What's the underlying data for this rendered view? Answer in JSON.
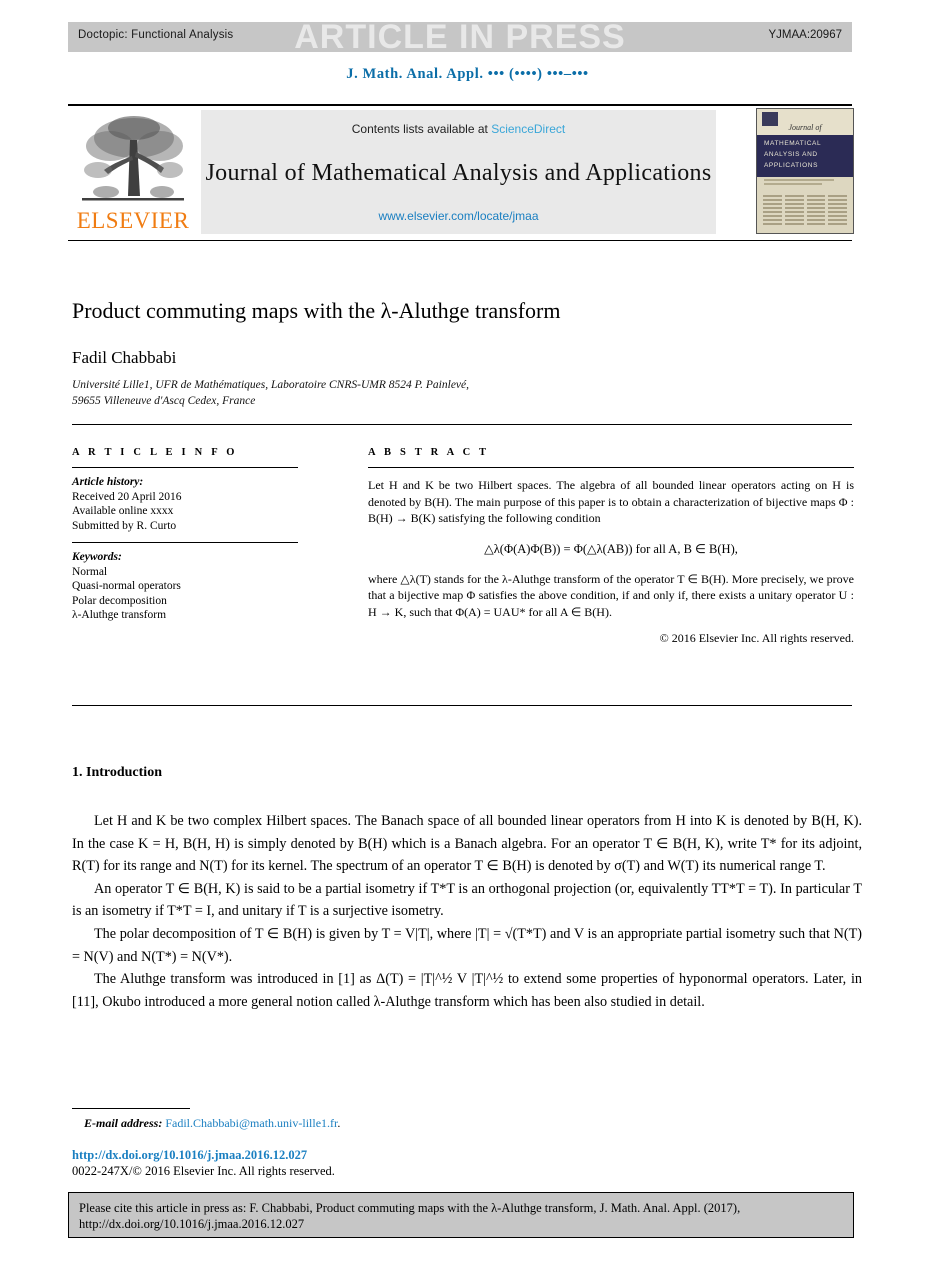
{
  "header": {
    "doctopic": "Doctopic: Functional Analysis",
    "press_banner": "ARTICLE IN PRESS",
    "article_number": "YJMAA:20967",
    "running_head": "J. Math. Anal. Appl. ••• (••••) •••–•••"
  },
  "masthead": {
    "contents_prefix": "Contents lists available at",
    "contents_link": "ScienceDirect",
    "journal_title": "Journal of Mathematical Analysis and Applications",
    "journal_url": "www.elsevier.com/locate/jmaa",
    "publisher": "ELSEVIER",
    "publisher_logo": "elsevier-tree-logo",
    "cover": {
      "journal_of": "Journal of",
      "band_line1": "MATHEMATICAL",
      "band_line2": "ANALYSIS AND",
      "band_line3": "APPLICATIONS"
    }
  },
  "article": {
    "title": "Product commuting maps with the λ-Aluthge transform",
    "author": "Fadil Chabbabi",
    "affiliation_line1": "Université Lille1, UFR de Mathématiques, Laboratoire CNRS-UMR 8524 P. Painlevé,",
    "affiliation_line2": "59655 Villeneuve d'Ascq Cedex, France"
  },
  "info": {
    "label": "A R T I C L E    I N F O",
    "history_heading": "Article history:",
    "history": [
      "Received 20 April 2016",
      "Available online xxxx",
      "Submitted by R. Curto"
    ],
    "keywords_heading": "Keywords:",
    "keywords": [
      "Normal",
      "Quasi-normal operators",
      "Polar decomposition",
      "λ-Aluthge transform"
    ]
  },
  "abstract": {
    "label": "A B S T R A C T",
    "para1": "Let H and K be two Hilbert spaces. The algebra of all bounded linear operators acting on H is denoted by B(H). The main purpose of this paper is to obtain a characterization of bijective maps Φ : B(H) → B(K) satisfying the following condition",
    "equation": "△λ(Φ(A)Φ(B)) = Φ(△λ(AB))   for all A, B ∈ B(H),",
    "para2": "where △λ(T) stands for the λ-Aluthge transform of the operator T ∈ B(H). More precisely, we prove that a bijective map Φ satisfies the above condition, if and only if, there exists a unitary operator U : H → K, such that Φ(A) = UAU* for all A ∈ B(H).",
    "copyright": "© 2016 Elsevier Inc. All rights reserved."
  },
  "body": {
    "section_heading": "1.  Introduction",
    "para1": "Let H and K be two complex Hilbert spaces. The Banach space of all bounded linear operators from H into K is denoted by B(H, K). In the case K = H, B(H, H) is simply denoted by B(H) which is a Banach algebra. For an operator T ∈ B(H, K), write T* for its adjoint, R(T) for its range and N(T) for its kernel. The spectrum of an operator T ∈ B(H) is denoted by σ(T) and W(T) its numerical range T.",
    "para2": "An operator T ∈ B(H, K) is said to be a partial isometry if T*T is an orthogonal projection (or, equivalently TT*T = T). In particular T is an isometry if T*T = I, and unitary if T is a surjective isometry.",
    "para3": "The polar decomposition of T ∈ B(H) is given by T = V|T|, where |T| = √(T*T) and V is an appropriate partial isometry such that N(T) = N(V) and N(T*) = N(V*).",
    "para4": "The Aluthge transform was introduced in [1] as Δ(T) = |T|^½ V |T|^½ to extend some properties of hyponormal operators. Later, in [11], Okubo introduced a more general notion called λ-Aluthge transform which has been also studied in detail.",
    "citation_1": "[1]",
    "citation_11": "[11]"
  },
  "footer": {
    "email_label": "E-mail address:",
    "email": "Fadil.Chabbabi@math.univ-lille1.fr",
    "email_period": ".",
    "doi": "http://dx.doi.org/10.1016/j.jmaa.2016.12.027",
    "issn_line": "0022-247X/© 2016 Elsevier Inc. All rights reserved.",
    "cite_box": "Please cite this article in press as: F. Chabbabi, Product commuting maps with the λ-Aluthge transform, J. Math. Anal. Appl. (2017), http://dx.doi.org/10.1016/j.jmaa.2016.12.027"
  },
  "colors": {
    "link": "#1a7fc1",
    "sciencedirect": "#3aa6d8",
    "running_head": "#0b6ea8",
    "elsevier_orange": "#f07c12",
    "banner_gray": "#c6c6c6",
    "cover_band": "#2b2b55"
  }
}
